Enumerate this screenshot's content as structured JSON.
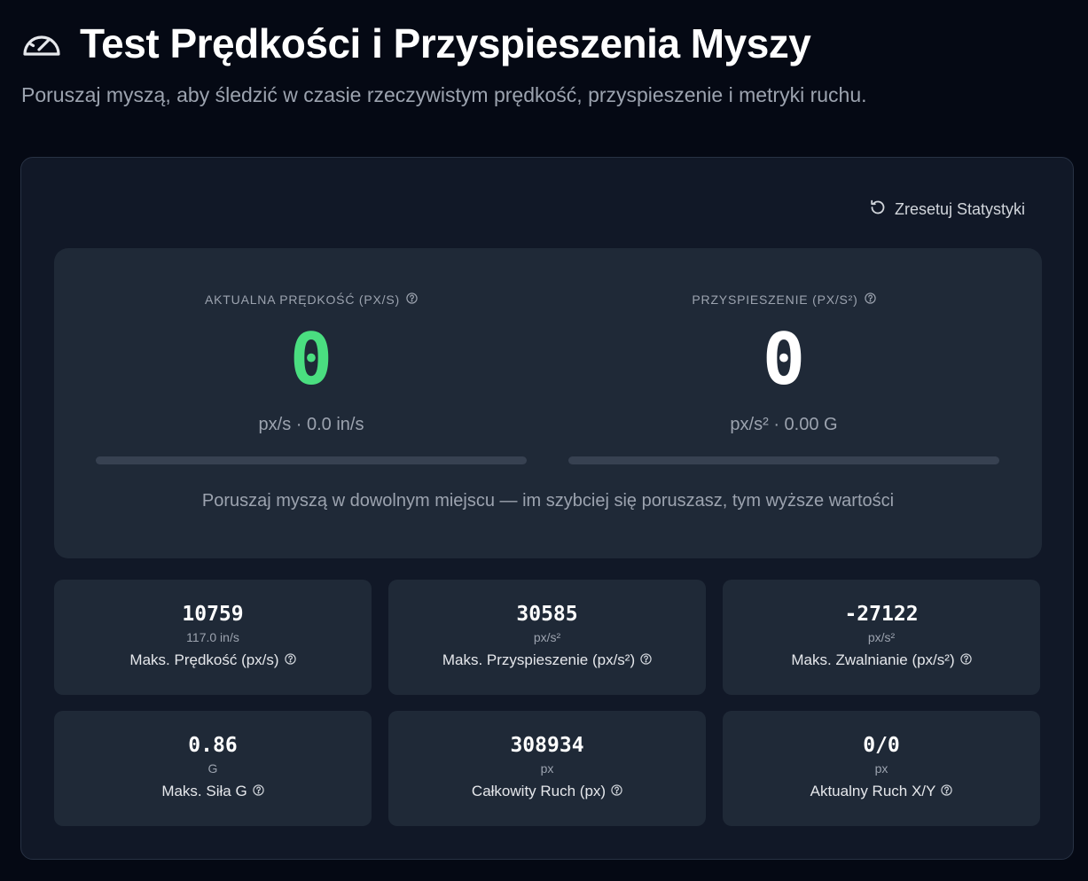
{
  "header": {
    "title": "Test Prędkości i Przyspieszenia Myszy",
    "subtitle": "Poruszaj myszą, aby śledzić w czasie rzeczywistym prędkość, przyspieszenie i metryki ruchu.",
    "icon": "speedometer-icon"
  },
  "toolbar": {
    "reset_label": "Zresetuj Statystyki",
    "reset_icon": "reset-icon"
  },
  "live": {
    "speed": {
      "label": "AKTUALNA PRĘDKOŚĆ (PX/S)",
      "value": "0",
      "unit": "px/s · 0.0 in/s",
      "progress": 0
    },
    "acceleration": {
      "label": "PRZYSPIESZENIE (PX/S²)",
      "value": "0",
      "unit": "px/s² · 0.00 G",
      "progress": 0
    },
    "hint": "Poruszaj myszą w dowolnym miejscu — im szybciej się poruszasz, tym wyższe wartości"
  },
  "stats": [
    {
      "value": "10759",
      "sub": "117.0 in/s",
      "label": "Maks. Prędkość (px/s)"
    },
    {
      "value": "30585",
      "sub": "px/s²",
      "label": "Maks. Przyspieszenie (px/s²)"
    },
    {
      "value": "-27122",
      "sub": "px/s²",
      "label": "Maks. Zwalnianie (px/s²)"
    },
    {
      "value": "0.86",
      "sub": "G",
      "label": "Maks. Siła G"
    },
    {
      "value": "308934",
      "sub": "px",
      "label": "Całkowity Ruch (px)"
    },
    {
      "value": "0/0",
      "sub": "px",
      "label": "Aktualny Ruch X/Y"
    }
  ],
  "colors": {
    "background": "#050914",
    "panel": "#111827",
    "card": "#1f2937",
    "accent_green": "#4ade80",
    "muted_text": "#9ca3af"
  }
}
